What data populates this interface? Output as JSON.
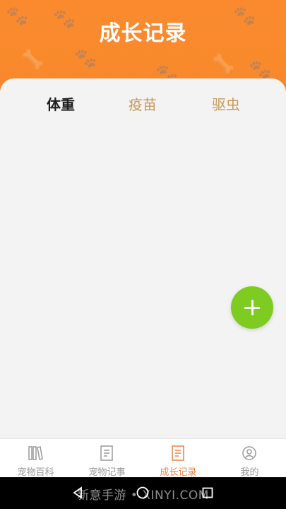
{
  "header": {
    "title": "成长记录"
  },
  "tabs": [
    {
      "label": "体重",
      "active": true
    },
    {
      "label": "疫苗",
      "active": false
    },
    {
      "label": "驱虫",
      "active": false
    }
  ],
  "colors": {
    "header": "#f98a2c",
    "fab": "#7ecb22",
    "tab_inactive": "#c79a5c",
    "nav_active": "#f0803a"
  },
  "fab": {
    "icon": "plus-icon"
  },
  "bottom_nav": [
    {
      "label": "宠物百科",
      "icon": "books-icon",
      "active": false
    },
    {
      "label": "宠物记事",
      "icon": "notebook-icon",
      "active": false
    },
    {
      "label": "成长记录",
      "icon": "record-icon",
      "active": true
    },
    {
      "label": "我的",
      "icon": "user-icon",
      "active": false
    }
  ],
  "watermark": "新意手游 • XINYI.COM"
}
